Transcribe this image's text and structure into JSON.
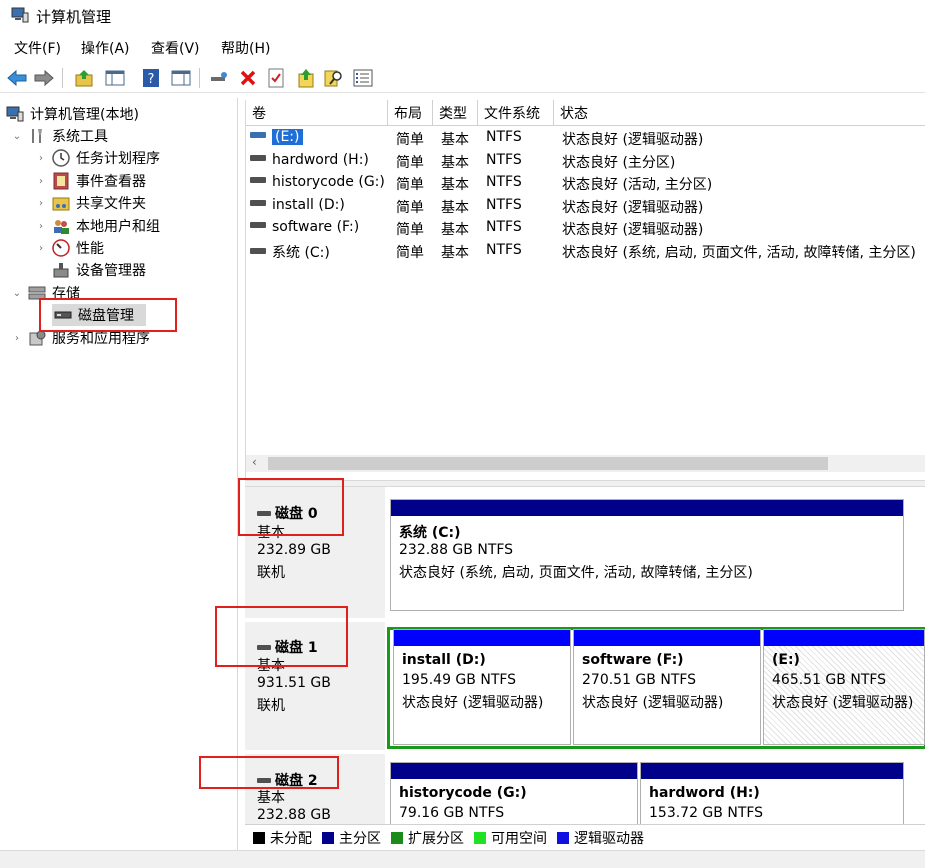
{
  "window": {
    "title": "计算机管理",
    "icon": "computer-management-icon"
  },
  "menu": [
    "文件(F)",
    "操作(A)",
    "查看(V)",
    "帮助(H)"
  ],
  "toolbar": {
    "icons": [
      "back-arrow-icon",
      "forward-arrow-icon",
      "up-folder-icon",
      "show-hide-tree-icon",
      "help-icon",
      "properties-pane-icon",
      "connect-icon",
      "delete-icon",
      "check-icon",
      "export-icon",
      "search-icon",
      "list-icon"
    ]
  },
  "tree": {
    "root": "计算机管理(本地)",
    "system_tools": "系统工具",
    "task_scheduler": "任务计划程序",
    "event_viewer": "事件查看器",
    "shared_folders": "共享文件夹",
    "local_users": "本地用户和组",
    "performance": "性能",
    "device_manager": "设备管理器",
    "storage": "存储",
    "disk_management": "磁盘管理",
    "services": "服务和应用程序"
  },
  "volume_list": {
    "columns": [
      "卷",
      "布局",
      "类型",
      "文件系统",
      "状态"
    ],
    "rows": [
      {
        "name": "(E:)",
        "layout": "简单",
        "type": "基本",
        "fs": "NTFS",
        "status": "状态良好 (逻辑驱动器)"
      },
      {
        "name": "hardword (H:)",
        "layout": "简单",
        "type": "基本",
        "fs": "NTFS",
        "status": "状态良好 (主分区)"
      },
      {
        "name": "historycode (G:)",
        "layout": "简单",
        "type": "基本",
        "fs": "NTFS",
        "status": "状态良好 (活动, 主分区)"
      },
      {
        "name": "install (D:)",
        "layout": "简单",
        "type": "基本",
        "fs": "NTFS",
        "status": "状态良好 (逻辑驱动器)"
      },
      {
        "name": "software (F:)",
        "layout": "简单",
        "type": "基本",
        "fs": "NTFS",
        "status": "状态良好 (逻辑驱动器)"
      },
      {
        "name": "系统 (C:)",
        "layout": "简单",
        "type": "基本",
        "fs": "NTFS",
        "status": "状态良好 (系统, 启动, 页面文件, 活动, 故障转储, 主分区)"
      }
    ]
  },
  "disks": [
    {
      "name": "磁盘 0",
      "type": "基本",
      "size": "232.89 GB",
      "state": "联机",
      "partitions": [
        {
          "name": "系统  (C:)",
          "size": "232.88 GB NTFS",
          "status": "状态良好 (系统, 启动, 页面文件, 活动, 故障转储, 主分区)"
        }
      ]
    },
    {
      "name": "磁盘 1",
      "type": "基本",
      "size": "931.51 GB",
      "state": "联机",
      "partitions": [
        {
          "name": "install  (D:)",
          "size": "195.49 GB NTFS",
          "status": "状态良好 (逻辑驱动器)"
        },
        {
          "name": "software  (F:)",
          "size": "270.51 GB NTFS",
          "status": "状态良好 (逻辑驱动器)"
        },
        {
          "name": "(E:)",
          "size": "465.51 GB NTFS",
          "status": "状态良好 (逻辑驱动器)"
        }
      ]
    },
    {
      "name": "磁盘 2",
      "type": "基本",
      "size": "232.88 GB",
      "state": "",
      "partitions": [
        {
          "name": "historycode  (G:)",
          "size": "79.16 GB NTFS",
          "status": ""
        },
        {
          "name": "hardword  (H:)",
          "size": "153.72 GB NTFS",
          "status": ""
        }
      ]
    }
  ],
  "legend": [
    {
      "label": "未分配",
      "color": "#000000"
    },
    {
      "label": "主分区",
      "color": "#00008b"
    },
    {
      "label": "扩展分区",
      "color": "#1a8a1a"
    },
    {
      "label": "可用空间",
      "color": "#22e022"
    },
    {
      "label": "逻辑驱动器",
      "color": "#1010e0"
    }
  ],
  "colors": {
    "primary_band": "#00008b",
    "logical_band": "#0000ff",
    "extended_border": "#1a9a1a",
    "highlight_box": "#e0201c"
  }
}
